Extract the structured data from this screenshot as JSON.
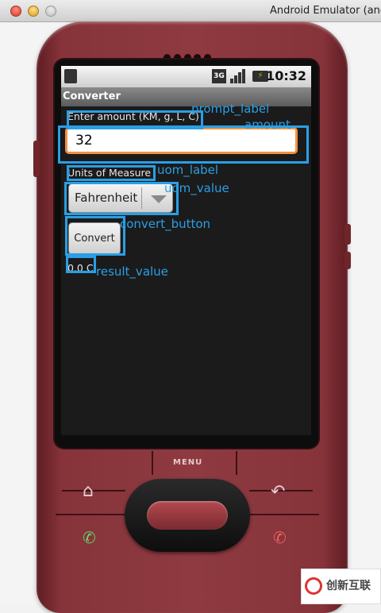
{
  "window": {
    "title": "Android Emulator (and"
  },
  "status_bar": {
    "network": "3G",
    "time": "10:32"
  },
  "app": {
    "title": "Converter",
    "prompt_label": "Enter amount (KM, g, L, C)",
    "amount_value": "32",
    "uom_label": "Units of Measure",
    "uom_selected": "Fahrenheit",
    "convert_button": "Convert",
    "result_value": "0.0 C"
  },
  "annotations": {
    "prompt_label": "prompt_label",
    "amount": "amount",
    "uom_label": "uom_label",
    "uom_value": "uom_value",
    "convert_button": "convert_button",
    "result_value": "result_value"
  },
  "phone": {
    "menu_label": "MENU"
  },
  "watermark": {
    "text": "创新互联"
  },
  "colors": {
    "annotation": "#2a9fe6",
    "phone_body": "#8e3a40",
    "input_focus": "#f09340"
  }
}
